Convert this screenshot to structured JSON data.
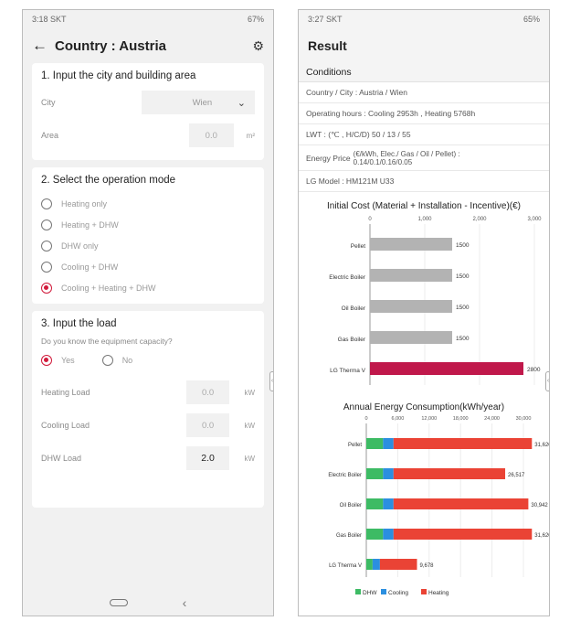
{
  "left": {
    "status_time": "3:18 SKT",
    "status_right": "67%",
    "title": "Country : Austria",
    "section1": {
      "heading": "1. Input the city and building area",
      "city_label": "City",
      "city_value": "Wien",
      "area_label": "Area",
      "area_value": "0.0",
      "area_unit": "m²"
    },
    "section2": {
      "heading": "2. Select the operation mode",
      "options": [
        "Heating only",
        "Heating + DHW",
        "DHW only",
        "Cooling + DHW",
        "Cooling + Heating + DHW"
      ],
      "selected_index": 4
    },
    "section3": {
      "heading": "3. Input the load",
      "question": "Do you know the equipment capacity?",
      "yes": "Yes",
      "no": "No",
      "heating_label": "Heating Load",
      "heating_value": "0.0",
      "cooling_label": "Cooling Load",
      "cooling_value": "0.0",
      "dhw_label": "DHW Load",
      "dhw_value": "2.0",
      "unit": "kW"
    }
  },
  "right": {
    "status_time": "3:27 SKT",
    "status_right": "65%",
    "title": "Result",
    "conditions_heading": "Conditions",
    "country": "Country / City : Austria / Wien",
    "hours": "Operating hours : Cooling 2953h , Heating 5768h",
    "lwt": "LWT : (℃ , H/C/D) 50 / 13 / 55",
    "energy_price_label": "Energy Price",
    "energy_price_line1": "(€/kWh, Elec./ Gas / Oil / Pellet) :",
    "energy_price_line2": "0.14/0.1/0.16/0.05",
    "model": "LG Model : HM121M U33"
  },
  "colors": {
    "accent": "#d11a3b",
    "bar_gray": "#b3b3b3",
    "bar_red": "#c0184b",
    "dhw": "#3dbb64",
    "cooling": "#2b8fe0",
    "heating": "#ea4335"
  },
  "chart_data": [
    {
      "type": "bar",
      "orientation": "horizontal",
      "title": "Initial Cost (Material + Installation - Incentive)(€)",
      "categories": [
        "Pellet",
        "Electric Boiler",
        "Oil Boiler",
        "Gas Boiler",
        "LG Therma V"
      ],
      "values": [
        1500,
        1500,
        1500,
        1500,
        2800
      ],
      "value_labels": [
        "1500",
        "1500",
        "1500",
        "1500",
        "2800"
      ],
      "ticks": [
        "0",
        "1,000",
        "2,000",
        "3,000"
      ],
      "xlim": [
        0,
        3000
      ]
    },
    {
      "type": "bar",
      "orientation": "horizontal",
      "stacked": true,
      "title": "Annual Energy Consumption(kWh/year)",
      "categories": [
        "Pellet",
        "Electric Boiler",
        "Oil Boiler",
        "Gas Boiler",
        "LG Therma V"
      ],
      "series": [
        {
          "name": "DHW",
          "values": [
            3200,
            3200,
            3200,
            3200,
            1200
          ]
        },
        {
          "name": "Cooling",
          "values": [
            2000,
            2000,
            2000,
            2000,
            1400
          ]
        },
        {
          "name": "Heating",
          "values": [
            26420,
            21317,
            25742,
            26420,
            7078
          ]
        }
      ],
      "totals": [
        "31,620",
        "26,517",
        "30,942",
        "31,620",
        "9,678"
      ],
      "ticks": [
        "0",
        "6,000",
        "12,000",
        "18,000",
        "24,000",
        "30,000"
      ],
      "xlim": [
        0,
        30000
      ],
      "legend": "bottom"
    }
  ]
}
